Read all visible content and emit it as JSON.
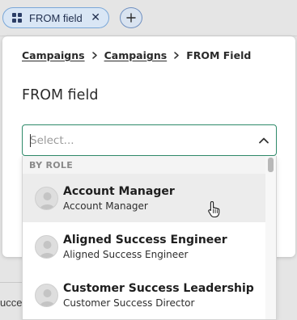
{
  "filter_chip": {
    "icon": "grid-icon",
    "label": "FROM field",
    "close_symbol": "✕"
  },
  "add_filter": {
    "icon": "plus-icon"
  },
  "background": {
    "row_text": "ucce"
  },
  "breadcrumb": {
    "items": [
      "Campaigns",
      "Campaigns"
    ],
    "current": "FROM Field"
  },
  "panel": {
    "title": "FROM field"
  },
  "select": {
    "placeholder": "Select...",
    "value": "",
    "accent_color": "#2f8a6a"
  },
  "dropdown": {
    "group_label": "BY ROLE",
    "options": [
      {
        "name": "Account Manager",
        "subtitle": "Account Manager",
        "hovered": true
      },
      {
        "name": "Aligned Success Engineer",
        "subtitle": "Aligned Success Engineer",
        "hovered": false
      },
      {
        "name": "Customer Success Leadership",
        "subtitle": "Customer Success Director",
        "hovered": false
      }
    ]
  }
}
